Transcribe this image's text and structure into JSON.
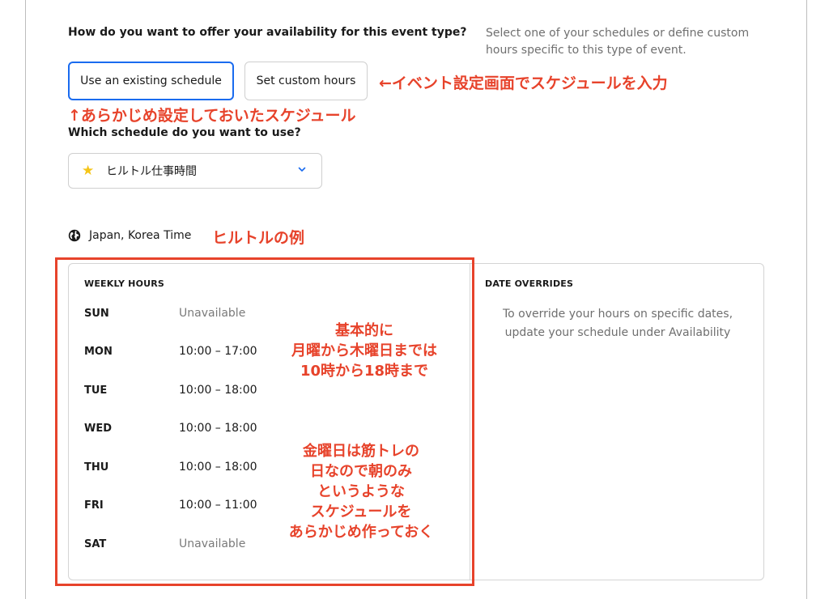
{
  "availability": {
    "question": "How do you want to offer your availability for this event type?",
    "hint": "Select one of your schedules or define custom hours specific to this type of event.",
    "option_existing": "Use an existing schedule",
    "option_custom": "Set custom hours"
  },
  "schedule": {
    "question": "Which schedule do you want to use?",
    "selected": "ヒルトル仕事時間",
    "icon": "star-icon"
  },
  "timezone": {
    "label": "Japan, Korea Time",
    "icon": "globe-icon"
  },
  "weekly": {
    "title": "WEEKLY HOURS",
    "days": [
      {
        "day": "SUN",
        "hours": "Unavailable"
      },
      {
        "day": "MON",
        "hours": "10:00 – 17:00"
      },
      {
        "day": "TUE",
        "hours": "10:00 – 18:00"
      },
      {
        "day": "WED",
        "hours": "10:00 – 18:00"
      },
      {
        "day": "THU",
        "hours": "10:00 – 18:00"
      },
      {
        "day": "FRI",
        "hours": "10:00 – 11:00"
      },
      {
        "day": "SAT",
        "hours": "Unavailable"
      }
    ]
  },
  "overrides": {
    "title": "DATE OVERRIDES",
    "line1": "To override your hours on specific dates,",
    "line2": "update your schedule under Availability"
  },
  "annotations": {
    "right": "←イベント設定画面でスケジュールを入力",
    "up": "↑あらかじめ設定しておいたスケジュール",
    "example": "ヒルトルの例",
    "note1": [
      "基本的に",
      "月曜から木曜日までは",
      "10時から18時まで"
    ],
    "note2": [
      "金曜日は筋トレの",
      "日なので朝のみ",
      "というような",
      "スケジュールを",
      "あらかじめ作っておく"
    ]
  },
  "colors": {
    "accent": "#1a6bef",
    "annotation": "#e7432b",
    "star": "#f5c518"
  }
}
